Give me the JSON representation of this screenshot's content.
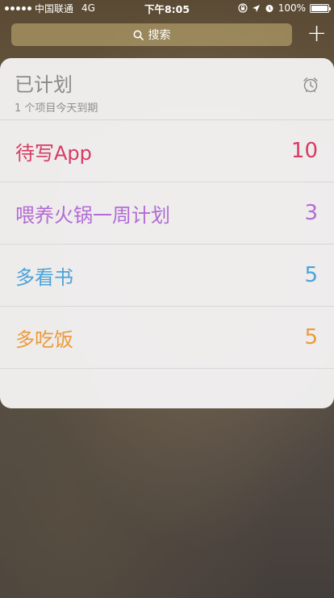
{
  "status_bar": {
    "carrier": "中国联通",
    "network": "4G",
    "time": "下午8:05",
    "battery": "100%"
  },
  "search": {
    "label": "搜索"
  },
  "add_button": {
    "label": "+"
  },
  "widget": {
    "title": "已计划",
    "subtitle": "1 个项目今天到期",
    "lists": [
      {
        "name": "待写App",
        "count": "10",
        "color": "#d63b63"
      },
      {
        "name": "喂养火锅一周计划",
        "count": "3",
        "color": "#b36bd6"
      },
      {
        "name": "多看书",
        "count": "5",
        "color": "#4aa3da"
      },
      {
        "name": "多吃饭",
        "count": "5",
        "color": "#eb9a3b"
      }
    ]
  },
  "icons": {
    "search": "search-icon",
    "alarm": "alarm-clock-icon",
    "location": "location-arrow-icon",
    "lock": "orientation-lock-icon"
  }
}
